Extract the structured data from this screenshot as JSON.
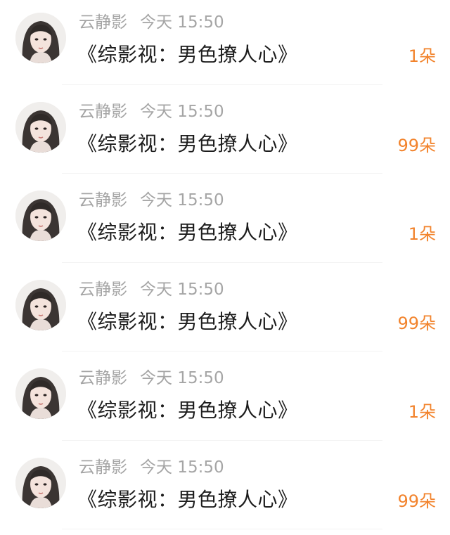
{
  "rows": [
    {
      "user": "云静影",
      "time": "今天 15:50",
      "title": "《综影视：男色撩人心》",
      "count": "1朵",
      "avatar": "avatar-portrait-icon"
    },
    {
      "user": "云静影",
      "time": "今天 15:50",
      "title": "《综影视：男色撩人心》",
      "count": "99朵",
      "avatar": "avatar-portrait-icon"
    },
    {
      "user": "云静影",
      "time": "今天 15:50",
      "title": "《综影视：男色撩人心》",
      "count": "1朵",
      "avatar": "avatar-portrait-icon"
    },
    {
      "user": "云静影",
      "time": "今天 15:50",
      "title": "《综影视：男色撩人心》",
      "count": "99朵",
      "avatar": "avatar-portrait-icon"
    },
    {
      "user": "云静影",
      "time": "今天 15:50",
      "title": "《综影视：男色撩人心》",
      "count": "1朵",
      "avatar": "avatar-portrait-icon"
    },
    {
      "user": "云静影",
      "time": "今天 15:50",
      "title": "《综影视：男色撩人心》",
      "count": "99朵",
      "avatar": "avatar-portrait-icon"
    }
  ],
  "colors": {
    "count": "#f2832c",
    "meta": "#a5a5a5",
    "title": "#1d1d1d"
  }
}
